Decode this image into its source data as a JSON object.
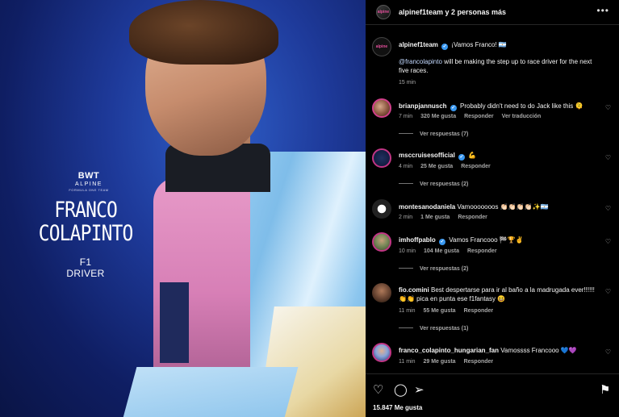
{
  "photo": {
    "brand_logo": "BWT",
    "brand_team": "ALPINE",
    "brand_sub": "FORMULA ONE TEAM",
    "driver_name_line1": "FRANCO",
    "driver_name_line2": "COLAPINTO",
    "driver_role": "F1 DRIVER"
  },
  "post_header": {
    "avatar_text": "alpine",
    "title": "alpinef1team y 2 personas más",
    "more_icon": "more-horizontal-icon"
  },
  "caption": {
    "username": "alpinef1team",
    "text": "¡Vamos Franco! 🇦🇷",
    "mention": "@francolapinto",
    "body": "will be making the step up to race driver for the next five races.",
    "time": "15 min"
  },
  "comments": [
    {
      "username": "brianpjannusch",
      "verified": true,
      "text": "Probably didn't need to do Jack like this 🫠",
      "time": "7 min",
      "likes": "320 Me gusta",
      "reply": "Responder",
      "translate": "Ver traducción",
      "replies": "Ver respuestas (7)"
    },
    {
      "username": "msccruisesofficial",
      "verified": true,
      "text": "💪",
      "time": "4 min",
      "likes": "25 Me gusta",
      "reply": "Responder",
      "replies": "Ver respuestas (2)"
    },
    {
      "username": "montesanodaniela",
      "verified": false,
      "text": "Vamooooooos 👏🏻👏🏻👏🏻👏🏻✨🇦🇷",
      "time": "2 min",
      "likes": "1 Me gusta",
      "reply": "Responder",
      "replies": ""
    },
    {
      "username": "imhoffpablo",
      "verified": true,
      "text": "Vamos Francooo 🏁🏆✌️",
      "time": "10 min",
      "likes": "104 Me gusta",
      "reply": "Responder",
      "replies": "Ver respuestas (2)"
    },
    {
      "username": "fio.comini",
      "verified": false,
      "text": "Best despertarse para ir al baño a la madrugada ever!!!!!! 👏👏 pica en punta ese f1fantasy 😆",
      "time": "11 min",
      "likes": "55 Me gusta",
      "reply": "Responder",
      "replies": "Ver respuestas (1)"
    },
    {
      "username": "franco_colapinto_hungarian_fan",
      "verified": false,
      "text": "Vamossss Francooo 💙💜",
      "time": "11 min",
      "likes": "29 Me gusta",
      "reply": "Responder",
      "replies": ""
    }
  ],
  "footer": {
    "likes": "15.847 Me gusta"
  }
}
